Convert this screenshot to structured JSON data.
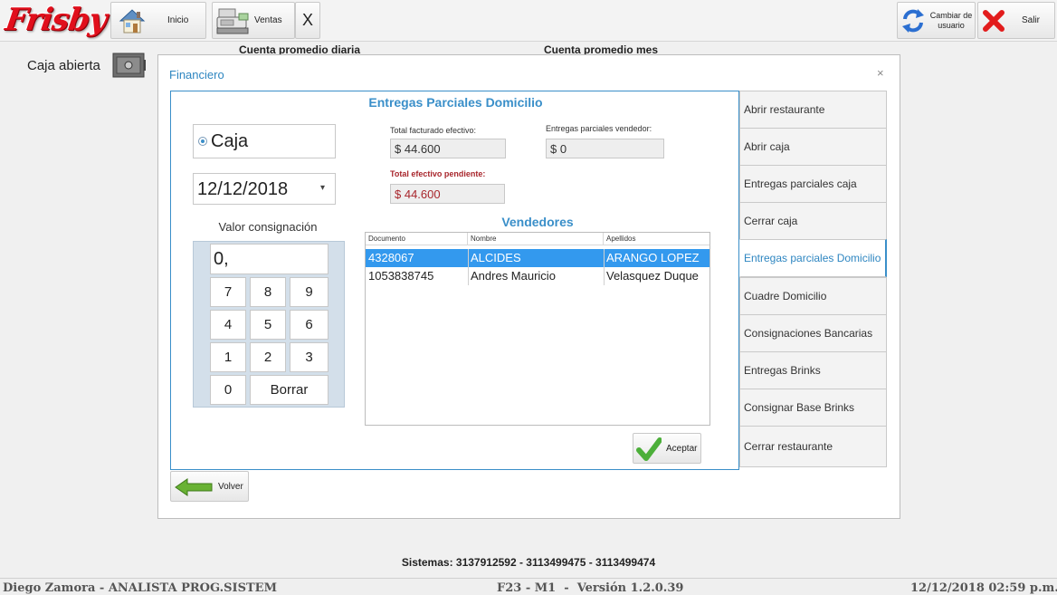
{
  "brand": {
    "logo_text": "Frisby"
  },
  "toolbar": {
    "home_label": "Inicio",
    "sales_label": "Ventas",
    "close_label": "X",
    "switch_user_label_line1": "Cambiar de",
    "switch_user_label_line2": "usuario",
    "exit_label": "Salir"
  },
  "dashboard": {
    "daily_avg_title": "Cuenta promedio diaria",
    "monthly_avg_title": "Cuenta promedio mes",
    "cash_status": "Caja abierta"
  },
  "modal": {
    "title": "Financiero",
    "close_icon": "×",
    "section_title": "Entregas Parciales Domicilio",
    "source_option": "Caja",
    "date_value": "12/12/2018",
    "consignment_label": "Valor consignación",
    "keypad_display": "0,",
    "keys": [
      "7",
      "8",
      "9",
      "4",
      "5",
      "6",
      "1",
      "2",
      "3",
      "0"
    ],
    "delete_label": "Borrar",
    "total_cash_label": "Total facturado efectivo:",
    "total_cash_value": "$ 44.600",
    "seller_deliveries_label": "Entregas parciales vendedor:",
    "seller_deliveries_value": "$ 0",
    "pending_cash_label": "Total efectivo pendiente:",
    "pending_cash_value": "$ 44.600",
    "sellers_title": "Vendedores",
    "sellers_columns": [
      "Documento",
      "Nombre",
      "Apellidos"
    ],
    "sellers_rows": [
      {
        "documento": "4328067",
        "nombre": "ALCIDES",
        "apellidos": "ARANGO LOPEZ",
        "selected": true
      },
      {
        "documento": "1053838745",
        "nombre": "Andres Mauricio",
        "apellidos": "Velasquez Duque",
        "selected": false
      }
    ],
    "accept_label": "Aceptar",
    "back_label": "Volver",
    "menu": [
      {
        "label": "Abrir restaurante",
        "active": false
      },
      {
        "label": "Abrir caja",
        "active": false
      },
      {
        "label": "Entregas parciales caja",
        "active": false
      },
      {
        "label": "Cerrar caja",
        "active": false
      },
      {
        "label": "Entregas parciales Domicilio",
        "active": true
      },
      {
        "label": "Cuadre Domicilio",
        "active": false
      },
      {
        "label": "Consignaciones Bancarias",
        "active": false
      },
      {
        "label": "Entregas Brinks",
        "active": false
      },
      {
        "label": "Consignar Base Brinks",
        "active": false
      },
      {
        "label": "Cerrar restaurante",
        "active": false
      }
    ]
  },
  "footer": {
    "support_phones": "Sistemas: 3137912592 - 3113499475 - 3113499474",
    "user_info": "Diego Zamora - ANALISTA PROG.SISTEM",
    "version_info": "F23 - M1  -  Versión 1.2.0.39",
    "datetime": "12/12/2018 02:59 p.m."
  },
  "colors": {
    "accent": "#3a8fc9",
    "brand_red": "#e10f1c",
    "selection": "#3399ee",
    "warning_text": "#a8262c"
  }
}
